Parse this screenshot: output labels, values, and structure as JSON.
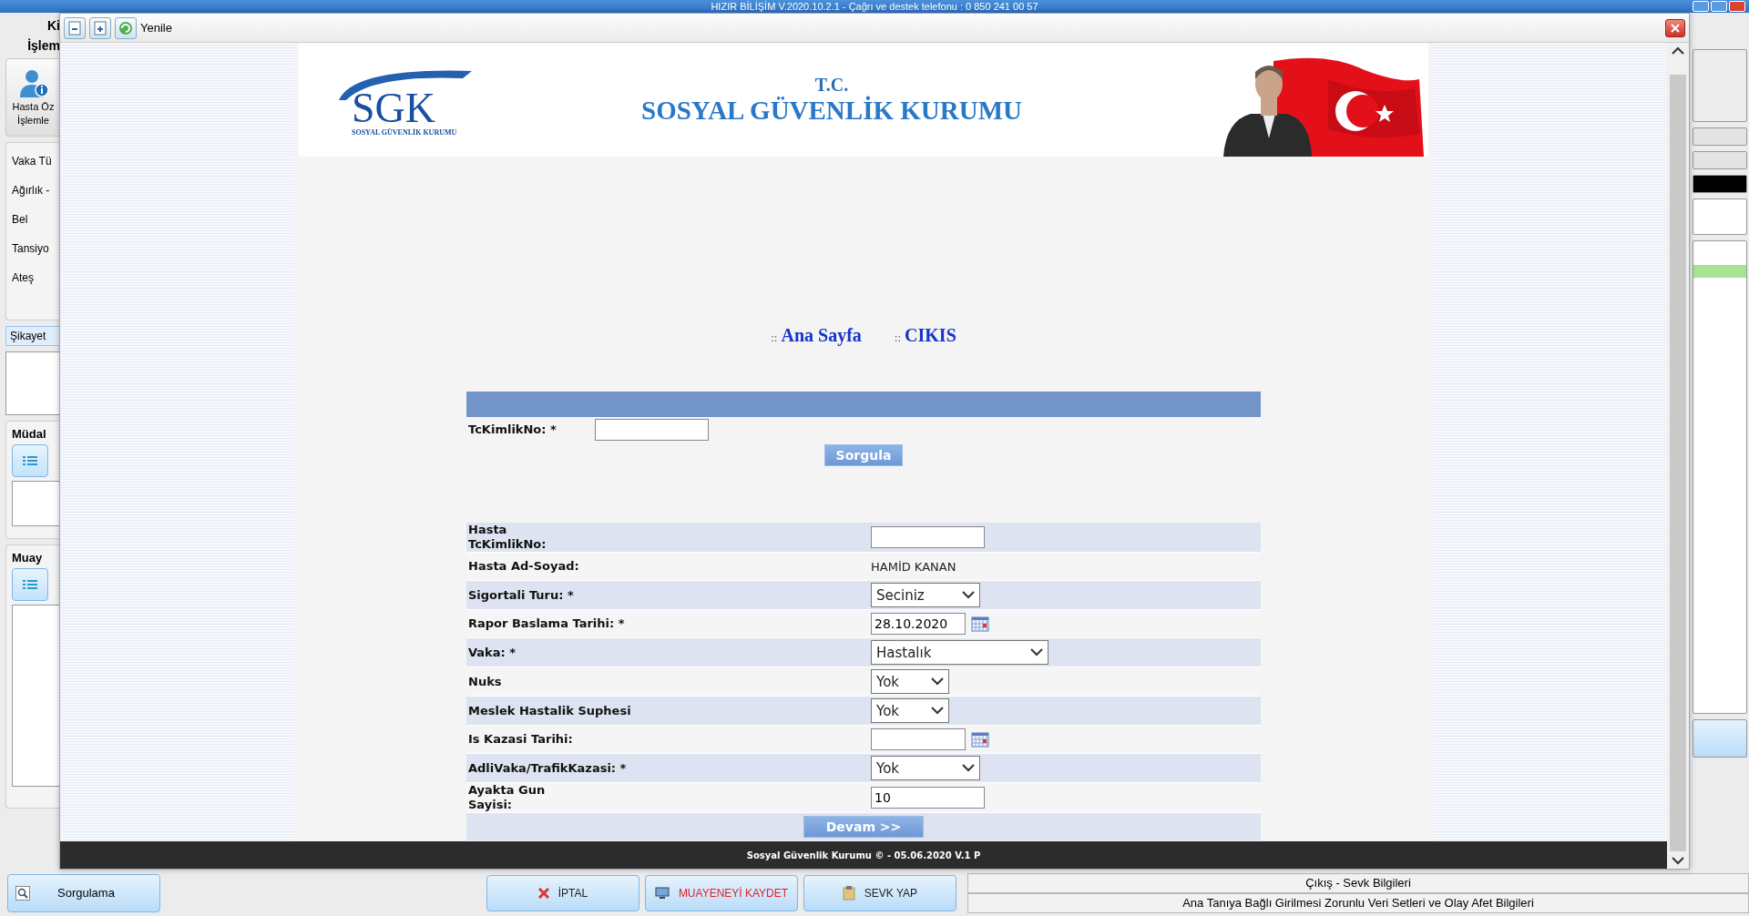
{
  "window": {
    "title": "HIZIR BİLİŞİM V.2020.10.2.1 - Çağrı ve destek telefonu : 0 850 241 00 57"
  },
  "sidebar": {
    "title_lines": [
      "Ki",
      "İşlem"
    ],
    "tool_label_lines": [
      "Hasta Öz",
      "İşlemle"
    ],
    "fields": [
      "Vaka Tü",
      "Ağırlık -",
      "Bel",
      "Tansiyo",
      "Ateş"
    ],
    "tab": "Şikayet",
    "groups": [
      "Müdal",
      "Muay"
    ],
    "search_button": "Sorgulama"
  },
  "dialog": {
    "toolbar_label": "Yenile",
    "header": {
      "logo_text": "SGK",
      "logo_subtext": "SOSYAL GÜVENLİK KURUMU",
      "tc": "T.C.",
      "title": "SOSYAL GÜVENLİK KURUMU"
    },
    "nav_links": [
      {
        "prefix": "::",
        "label": "Ana Sayfa"
      },
      {
        "prefix": "::",
        "label": "CIKIS"
      }
    ],
    "query": {
      "label": "TcKimlikNo: *",
      "button": "Sorgula"
    },
    "fields": [
      {
        "kind": "input",
        "label": "Hasta TcKimlikNo:"
      },
      {
        "kind": "text",
        "label": "Hasta Ad-Soyad:",
        "value": "HAMİD KANAN"
      },
      {
        "kind": "select",
        "label": "Sigortali Turu: *",
        "value": "Seciniz"
      },
      {
        "kind": "date",
        "label": "Rapor Baslama Tarihi: *",
        "value": "28.10.2020"
      },
      {
        "kind": "select",
        "label": "Vaka: *",
        "value": "Hastalık"
      },
      {
        "kind": "select",
        "label": "Nuks",
        "value": "Yok"
      },
      {
        "kind": "select",
        "label": "Meslek Hastalik Suphesi",
        "value": "Yok"
      },
      {
        "kind": "date",
        "label": "Is Kazasi Tarihi:"
      },
      {
        "kind": "select",
        "label": "AdliVaka/TrafikKazasi: *",
        "value": "Yok"
      },
      {
        "kind": "input",
        "label": "Ayakta Gun Sayisi:",
        "value": "10"
      }
    ],
    "submit": "Devam >>",
    "footer": "Sosyal Güvenlik Kurumu © - 05.06.2020 V.1 P"
  },
  "bottom": {
    "buttons": [
      {
        "kind": "cancel",
        "label": "İPTAL"
      },
      {
        "kind": "save",
        "label": "MUAYENEYİ KAYDET"
      },
      {
        "kind": "refer",
        "label": "SEVK YAP"
      }
    ],
    "info_rows": [
      "Çıkış - Sevk Bilgileri",
      "Ana Tanıya Bağlı Girilmesi Zorunlu Veri Setleri ve Olay Afet Bilgileri"
    ]
  }
}
